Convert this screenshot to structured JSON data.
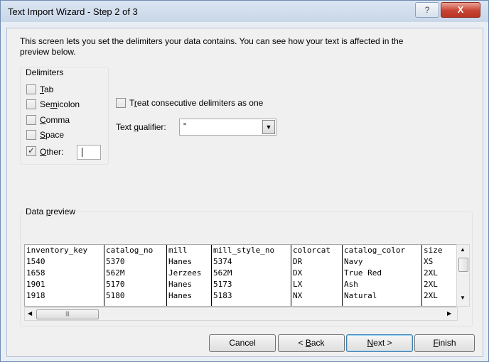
{
  "window": {
    "title": "Text Import Wizard - Step 2 of 3",
    "help_label": "?",
    "close_label": "X"
  },
  "intro": {
    "line1": "This screen lets you set the delimiters your data contains.  You can see how your text is affected in the",
    "line2": "preview below."
  },
  "delimiters": {
    "legend": "Delimiters",
    "tab": {
      "label_pre": "",
      "mnemonic": "T",
      "label_post": "ab",
      "checked": false
    },
    "semicolon": {
      "label_pre": "Se",
      "mnemonic": "m",
      "label_post": "icolon",
      "checked": false
    },
    "comma": {
      "label_pre": "",
      "mnemonic": "C",
      "label_post": "omma",
      "checked": false
    },
    "space": {
      "label_pre": "",
      "mnemonic": "S",
      "label_post": "pace",
      "checked": false
    },
    "other": {
      "label_pre": "",
      "mnemonic": "O",
      "label_post": "ther:",
      "checked": true,
      "value": ""
    }
  },
  "consecutive": {
    "label_pre": "T",
    "mnemonic": "r",
    "label_post": "eat consecutive delimiters as one",
    "checked": false
  },
  "qualifier": {
    "label_pre": "Text ",
    "mnemonic": "q",
    "label_post": "ualifier:",
    "value": "\""
  },
  "preview": {
    "legend_pre": "Data ",
    "legend_mnemonic": "p",
    "legend_post": "review",
    "columns": [
      {
        "cells": [
          "inventory_key",
          "1540",
          "1658",
          "1901",
          "1918"
        ]
      },
      {
        "cells": [
          "catalog_no",
          "5370",
          "562M",
          "5170",
          "5180"
        ]
      },
      {
        "cells": [
          "mill",
          "Hanes",
          "Jerzees",
          "Hanes",
          "Hanes"
        ]
      },
      {
        "cells": [
          "mill_style_no",
          "5374",
          "562M",
          "5173",
          "5183"
        ]
      },
      {
        "cells": [
          "colorcat",
          "DR",
          "DX",
          "LX",
          "NX"
        ]
      },
      {
        "cells": [
          "catalog_color",
          "Navy",
          "True Red",
          "Ash",
          "Natural"
        ]
      },
      {
        "cells": [
          "size",
          "XS",
          "2XL",
          "2XL",
          "2XL"
        ]
      }
    ]
  },
  "buttons": {
    "cancel": "Cancel",
    "back": {
      "pre": "< ",
      "mnemonic": "B",
      "post": "ack"
    },
    "next": {
      "pre": "",
      "mnemonic": "N",
      "post": "ext >"
    },
    "finish": {
      "pre": "",
      "mnemonic": "F",
      "post": "inish"
    }
  },
  "icons": {
    "scroll_up": "scroll-up-arrow",
    "scroll_down": "scroll-down-arrow",
    "scroll_left": "scroll-left-arrow",
    "scroll_right": "scroll-right-arrow",
    "dropdown": "chevron-down-icon"
  }
}
